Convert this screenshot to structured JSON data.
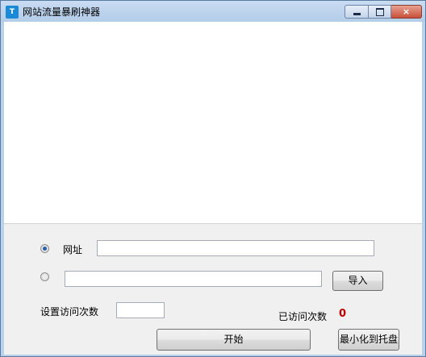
{
  "window": {
    "title": "网站流量暴刷神器",
    "icon_text": "T",
    "controls": {
      "minimize": "minimize",
      "maximize": "maximize",
      "close": "×"
    }
  },
  "form": {
    "url_radio_label": "网址",
    "url_value": "",
    "file_path_value": "",
    "import_button": "导入",
    "visit_count_label": "设置访问次数",
    "visit_count_value": "",
    "visited_label": "已访问次数",
    "visited_count": "0",
    "start_button": "开始",
    "minimize_to_tray_button": "最小化到托盘"
  },
  "colors": {
    "counter": "#c00000",
    "window_frame": "#b9d1ea",
    "panel": "#f0f0f0"
  },
  "state": {
    "url_radio_checked": true,
    "import_radio_checked": false
  }
}
